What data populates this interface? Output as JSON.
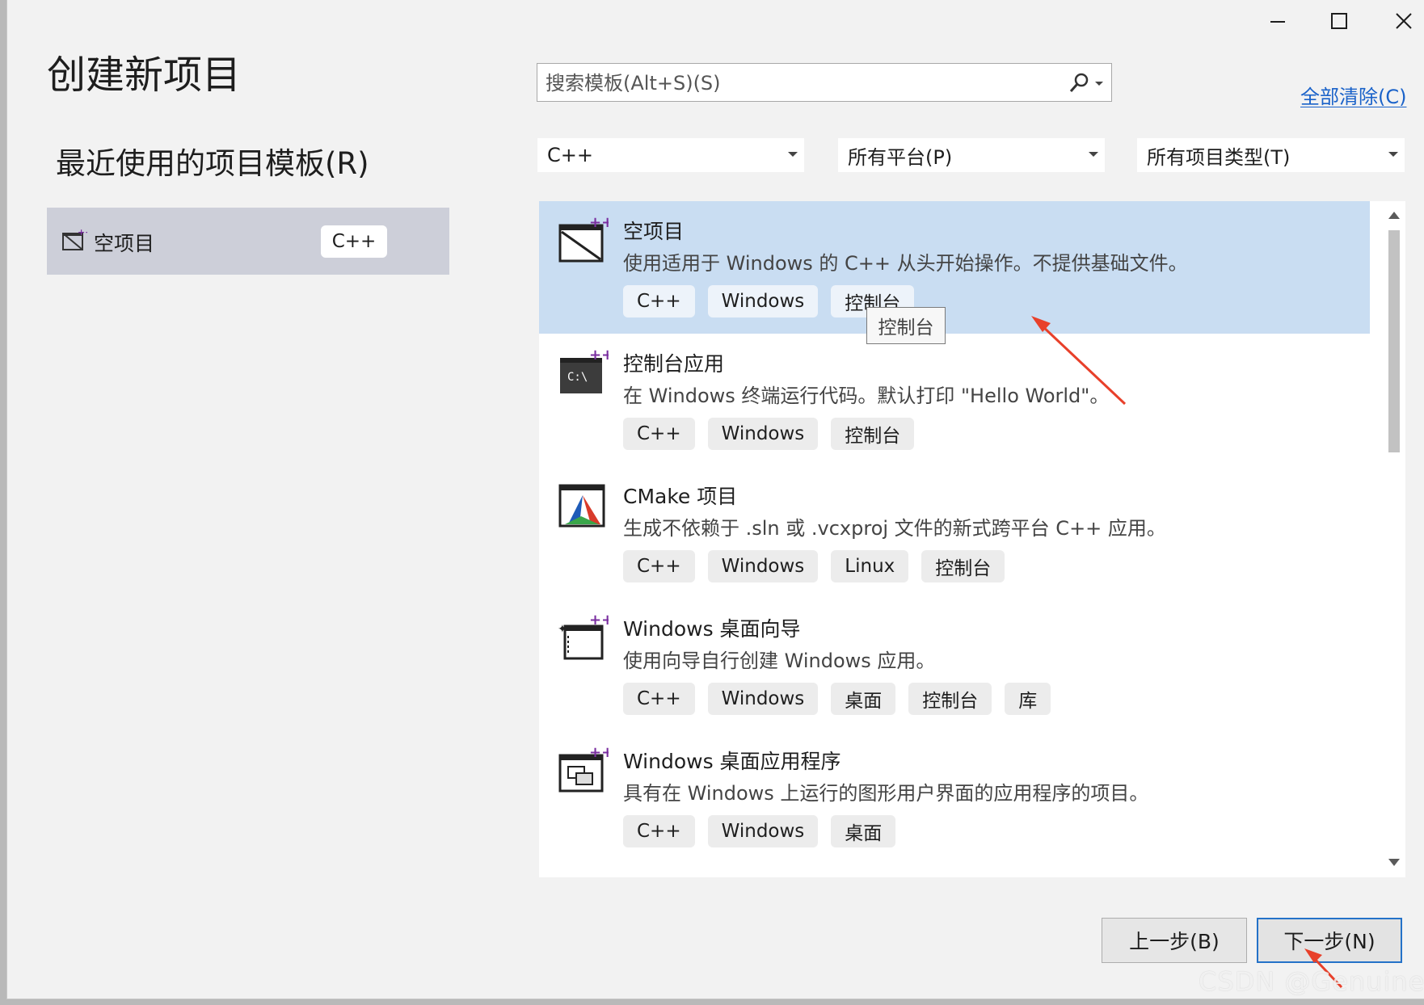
{
  "window": {
    "title": "创建新项目",
    "controls": {
      "minimize": "minimize",
      "maximize": "maximize",
      "close": "close"
    }
  },
  "recent": {
    "heading": "最近使用的项目模板(R)",
    "items": [
      {
        "name": "空项目",
        "tag": "C++",
        "icon": "empty-project-icon"
      }
    ]
  },
  "search": {
    "placeholder": "搜索模板(Alt+S)(S)",
    "icon": "search-icon"
  },
  "clear_all": "全部清除(C)",
  "filters": {
    "language": "C++",
    "platform": "所有平台(P)",
    "project_type": "所有项目类型(T)"
  },
  "templates": [
    {
      "name": "空项目",
      "description": "使用适用于 Windows 的 C++ 从头开始操作。不提供基础文件。",
      "tags": [
        "C++",
        "Windows",
        "控制台"
      ],
      "icon": "empty-project-icon",
      "selected": true
    },
    {
      "name": "控制台应用",
      "description": "在 Windows 终端运行代码。默认打印 \"Hello World\"。",
      "tags": [
        "C++",
        "Windows",
        "控制台"
      ],
      "icon": "console-app-icon"
    },
    {
      "name": "CMake 项目",
      "description": "生成不依赖于 .sln 或 .vcxproj 文件的新式跨平台 C++ 应用。",
      "tags": [
        "C++",
        "Windows",
        "Linux",
        "控制台"
      ],
      "icon": "cmake-icon"
    },
    {
      "name": "Windows 桌面向导",
      "description": "使用向导自行创建 Windows 应用。",
      "tags": [
        "C++",
        "Windows",
        "桌面",
        "控制台",
        "库"
      ],
      "icon": "desktop-wizard-icon"
    },
    {
      "name": "Windows 桌面应用程序",
      "description": "具有在 Windows 上运行的图形用户界面的应用程序的项目。",
      "tags": [
        "C++",
        "Windows",
        "桌面"
      ],
      "icon": "desktop-app-icon"
    }
  ],
  "tooltip": "控制台",
  "buttons": {
    "back": "上一步(B)",
    "next": "下一步(N)"
  },
  "watermark": "CSDN @Genuine..",
  "colors": {
    "accent": "#1a62c9",
    "selected_bg": "#c9ddf2",
    "annotation_arrow": "#e8402a"
  }
}
